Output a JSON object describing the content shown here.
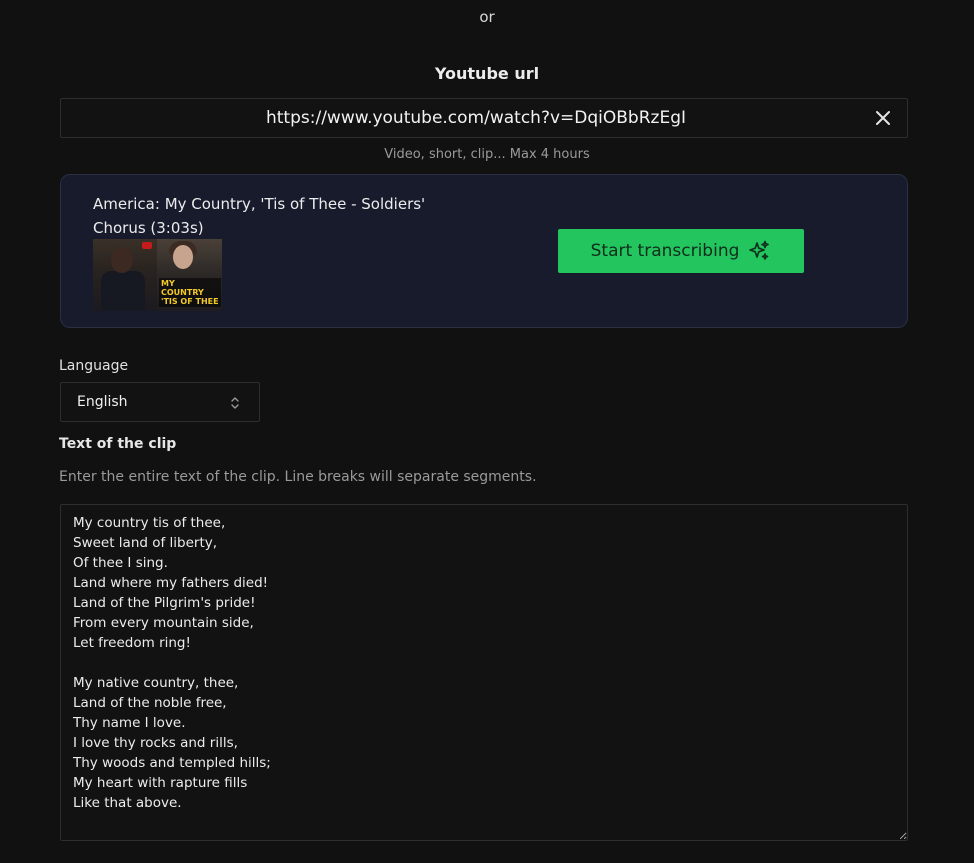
{
  "divider": {
    "or_label": "or"
  },
  "youtube": {
    "title": "Youtube url",
    "url_value": "https://www.youtube.com/watch?v=DqiOBbRzEgI",
    "hint": "Video, short, clip... Max 4 hours"
  },
  "video_card": {
    "title": "America: My Country, 'Tis of Thee - Soldiers' Chorus (3:03s)",
    "thumbnail_caption": "MY COUNTRY 'TIS OF THEE",
    "start_button_label": "Start transcribing",
    "start_button_icon": "sparkles-icon"
  },
  "language": {
    "label": "Language",
    "selected": "English"
  },
  "clip_text": {
    "label": "Text of the clip",
    "hint": "Enter the entire text of the clip. Line breaks will separate segments.",
    "value": "My country tis of thee,\nSweet land of liberty,\nOf thee I sing.\nLand where my fathers died!\nLand of the Pilgrim's pride!\nFrom every mountain side,\nLet freedom ring!\n\nMy native country, thee,\nLand of the noble free,\nThy name I love.\nI love thy rocks and rills,\nThy woods and templed hills;\nMy heart with rapture fills\nLike that above."
  },
  "colors": {
    "background": "#111111",
    "card": "#171b2c",
    "accent": "#22c55e"
  }
}
